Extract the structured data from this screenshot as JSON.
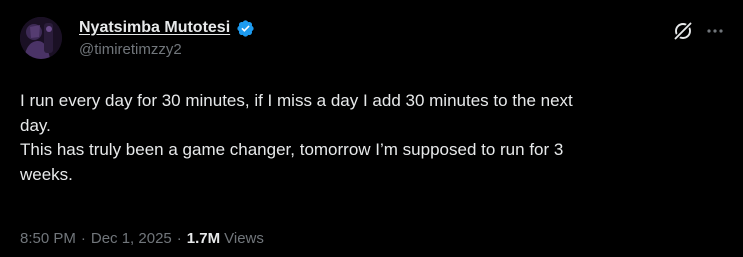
{
  "author": {
    "display_name": "Nyatsimba Mutotesi",
    "handle": "@timiretimzzy2",
    "verified_icon": "verified-badge-icon",
    "avatar_icon": "profile-photo"
  },
  "tweet": {
    "lines": [
      "I run every day for 30 minutes, if I miss a day I add 30 minutes to the next",
      "day.",
      "This has truly been a game changer, tomorrow I’m supposed to run for 3",
      "weeks."
    ]
  },
  "meta": {
    "time": "8:50 PM",
    "separator": "·",
    "date": "Dec 1, 2025",
    "views_count": "1.7M",
    "views_label": "Views"
  },
  "actions": {
    "grok_icon": "grok-icon",
    "more_icon": "more-options-icon"
  },
  "colors": {
    "background": "#000000",
    "primary_text": "#e7e9ea",
    "secondary_text": "#71767b",
    "verified": "#1d9bf0"
  }
}
